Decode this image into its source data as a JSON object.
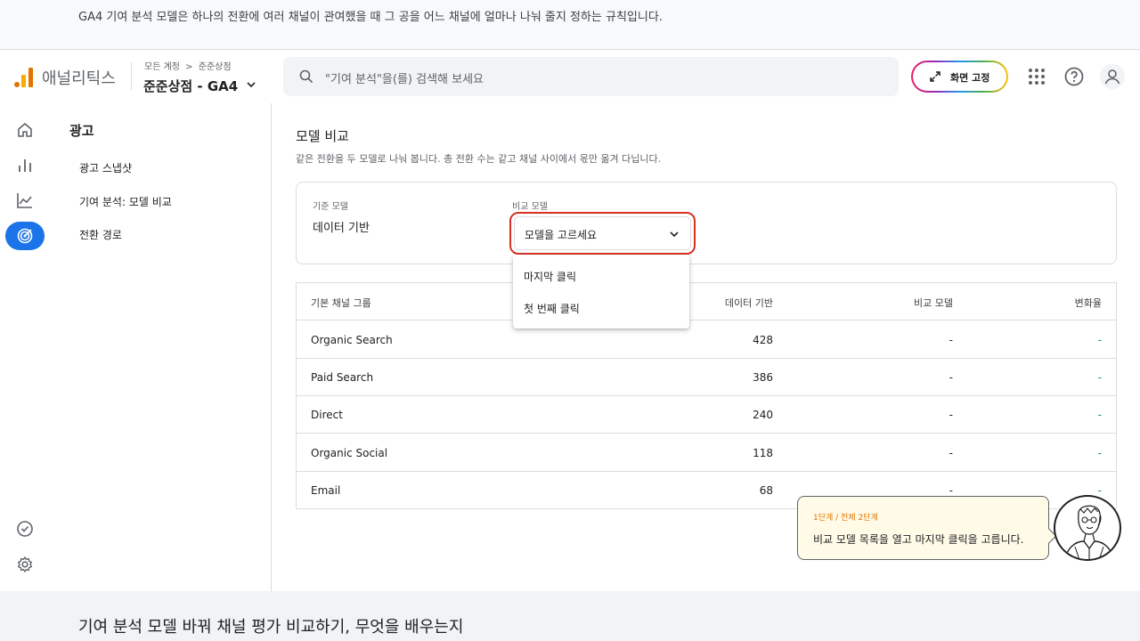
{
  "top_caption": "GA4 기여 분석 모델은 하나의 전환에 여러 채널이 관여했을 때 그 공을 어느 채널에 얼마나 나눠 줄지 정하는 규칙입니다.",
  "bottom_caption": "기여 분석 모델 바꿔 채널 평가 비교하기, 무엇을 배우는지",
  "header": {
    "app_name": "애널리틱스",
    "breadcrumb": [
      "모든 계정",
      "준준상점"
    ],
    "breadcrumb_sep": ">",
    "property": "준준상점 - GA4",
    "search_placeholder": "\"기여 분석\"을(를) 검색해 보세요",
    "pin_label": "화면 고정"
  },
  "subnav": {
    "title": "광고",
    "items": [
      "광고 스냅샷",
      "기여 분석: 모델 비교",
      "전환 경로"
    ]
  },
  "main": {
    "title": "모델 비교",
    "description": "같은 전환을 두 모델로 나눠 봅니다. 총 전환 수는 같고 채널 사이에서 몫만 옮겨 다닙니다.",
    "base_model_label": "기준 모델",
    "base_model_value": "데이터 기반",
    "compare_model_label": "비교 모델",
    "compare_model_value": "모델을 고르세요",
    "dropdown_options": [
      "마지막 클릭",
      "첫 번째 클릭"
    ]
  },
  "table": {
    "columns": [
      "기본 채널 그룹",
      "데이터 기반",
      "비교 모델",
      "변화율"
    ],
    "rows": [
      {
        "channel": "Organic Search",
        "data_driven": "428",
        "compare": "-",
        "change": "-"
      },
      {
        "channel": "Paid Search",
        "data_driven": "386",
        "compare": "-",
        "change": "-"
      },
      {
        "channel": "Direct",
        "data_driven": "240",
        "compare": "-",
        "change": "-"
      },
      {
        "channel": "Organic Social",
        "data_driven": "118",
        "compare": "-",
        "change": "-"
      },
      {
        "channel": "Email",
        "data_driven": "68",
        "compare": "-",
        "change": "-"
      }
    ]
  },
  "guide": {
    "step": "1단계 / 전체 2단계",
    "message": "비교 모델 목록을 열고 마지막 클릭을 고릅니다."
  },
  "colors": {
    "active_rail": "#1a73e8",
    "highlight_border": "#d93025",
    "change_positive": "#1e8e3e",
    "guide_bg": "#fffbe7"
  }
}
